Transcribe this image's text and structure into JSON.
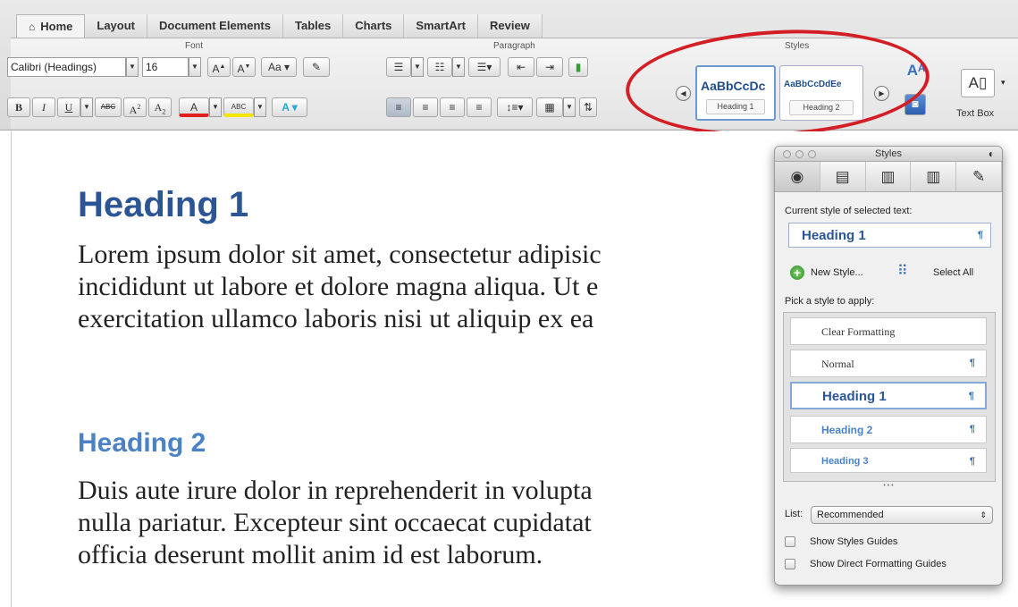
{
  "ribbon": {
    "tabs": [
      {
        "label": "Home",
        "active": true
      },
      {
        "label": "Layout"
      },
      {
        "label": "Document Elements"
      },
      {
        "label": "Tables"
      },
      {
        "label": "Charts"
      },
      {
        "label": "SmartArt"
      },
      {
        "label": "Review"
      }
    ],
    "groups": {
      "font": "Font",
      "paragraph": "Paragraph",
      "styles": "Styles"
    },
    "font": {
      "name": "Calibri (Headings)",
      "size": "16",
      "grow": "A",
      "shrink": "A",
      "bold": "B",
      "italic": "I",
      "underline": "U",
      "strike": "ABC",
      "superscript": "A",
      "sup_mark": "2",
      "subscript": "A",
      "sub_mark": "2",
      "color_a": "A",
      "effects_a": "A",
      "change_case": "Aa",
      "highlight": "ABC"
    },
    "styles_gallery": [
      {
        "sample": "AaBbCcDc",
        "caption": "Heading 1"
      },
      {
        "sample": "AaBbCcDdEe",
        "caption": "Heading 2"
      }
    ],
    "text_box": {
      "glyph": "A",
      "label": "Text Box"
    },
    "highlight_color": "#d21e24"
  },
  "document": {
    "heading1": "Heading 1",
    "para1": [
      "Lorem ipsum dolor sit amet, consectetur adipisic",
      "incididunt ut labore et dolore magna aliqua. Ut e",
      "exercitation ullamco laboris nisi ut aliquip ex ea"
    ],
    "heading2": "Heading 2",
    "para2": [
      "Duis aute irure dolor in reprehenderit in volupta",
      "nulla pariatur. Excepteur sint occaecat cupidatat",
      "officia deserunt mollit anim id est laborum."
    ],
    "heading1_color": "#2c5596",
    "heading2_color": "#4a82c4"
  },
  "palette": {
    "title": "Styles",
    "current_label": "Current style of selected text:",
    "current_value": "Heading 1",
    "pilcrow": "¶",
    "new_style": "New Style...",
    "select_all": "Select All",
    "pick_label": "Pick a style to apply:",
    "styles": [
      {
        "name": "Clear Formatting",
        "mark": ""
      },
      {
        "name": "Normal",
        "mark": "¶"
      },
      {
        "name": "Heading 1",
        "mark": "¶",
        "selected": true
      },
      {
        "name": "Heading 2",
        "mark": "¶"
      },
      {
        "name": "Heading 3",
        "mark": "¶"
      }
    ],
    "more": "• • •",
    "list_label": "List:",
    "list_value": "Recommended",
    "show_styles_guides": "Show Styles Guides",
    "show_direct_guides": "Show Direct Formatting Guides"
  }
}
